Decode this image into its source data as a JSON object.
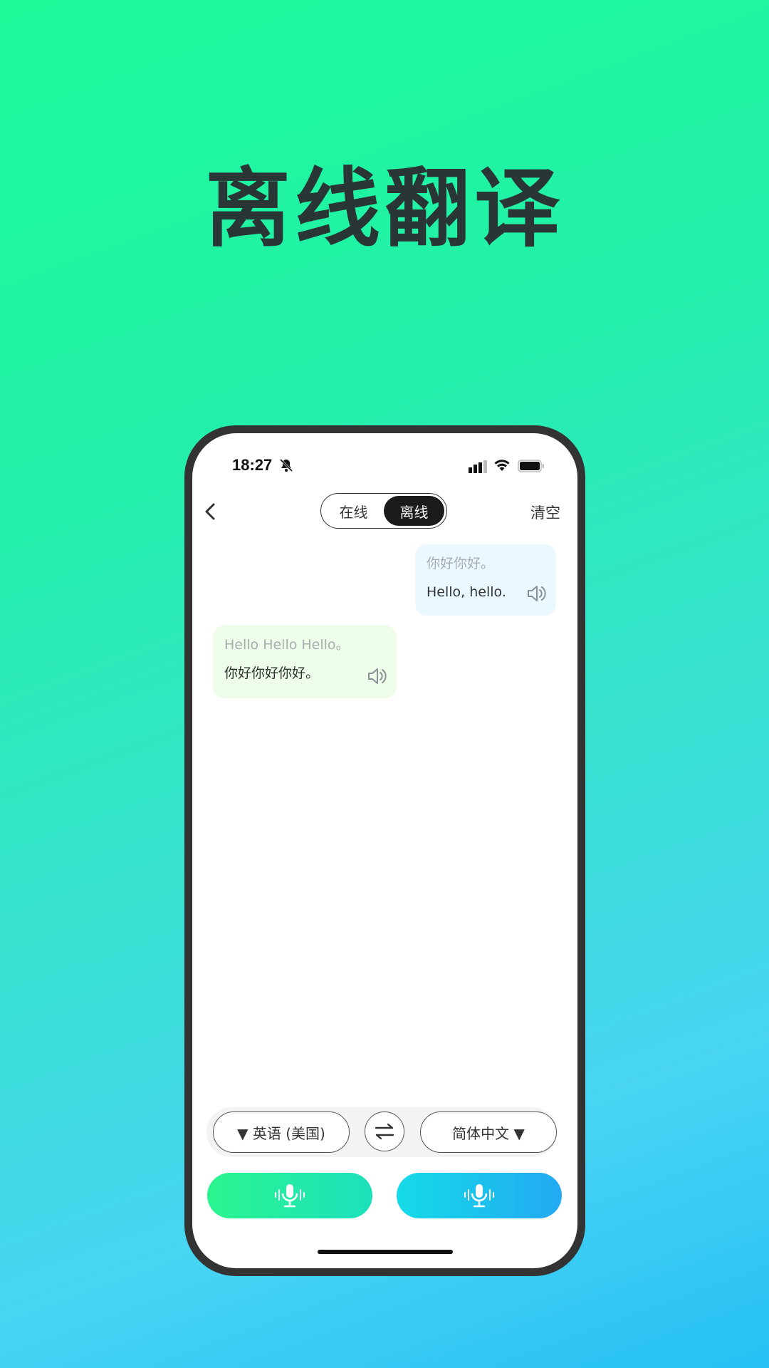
{
  "hero": {
    "title": "离线翻译"
  },
  "status": {
    "time": "18:27"
  },
  "nav": {
    "segments": [
      "在线",
      "离线"
    ],
    "active_segment": "离线",
    "clear_label": "清空"
  },
  "messages": [
    {
      "side": "right",
      "source": "你好你好。",
      "translation": "Hello, hello."
    },
    {
      "side": "left",
      "source": "Hello Hello Hello。",
      "translation": "你好你好你好。"
    }
  ],
  "languages": {
    "source": "▼ 英语 (美国)",
    "target": "简体中文 ▼"
  },
  "icons": {
    "back": "chevron-left-icon",
    "speaker": "speaker-icon",
    "swap": "swap-arrows-icon",
    "mic": "microphone-icon",
    "status": [
      "bell-off-icon",
      "signal-icon",
      "wifi-icon",
      "battery-icon"
    ]
  },
  "colors": {
    "right_bubble": "#eaf8ff",
    "left_bubble": "#eefdea",
    "mic_left_gradient": [
      "#2af58e",
      "#1de0bd"
    ],
    "mic_right_gradient": [
      "#15dbe8",
      "#23a9f2"
    ]
  }
}
